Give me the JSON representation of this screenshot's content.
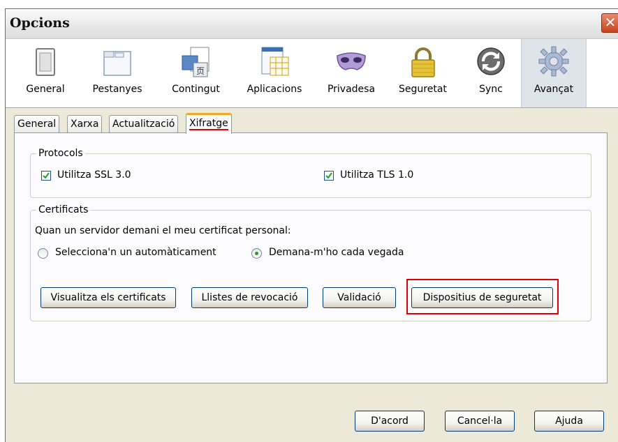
{
  "window": {
    "title": "Opcions",
    "close_glyph": "✕"
  },
  "toolbar": {
    "items": [
      {
        "label": "General",
        "icon": "general-icon"
      },
      {
        "label": "Pestanyes",
        "icon": "tabs-icon"
      },
      {
        "label": "Contingut",
        "icon": "content-icon"
      },
      {
        "label": "Aplicacions",
        "icon": "applications-icon"
      },
      {
        "label": "Privadesa",
        "icon": "privacy-mask-icon"
      },
      {
        "label": "Seguretat",
        "icon": "lock-icon"
      },
      {
        "label": "Sync",
        "icon": "sync-icon"
      },
      {
        "label": "Avançat",
        "icon": "gear-icon",
        "active": true
      }
    ]
  },
  "tabs": {
    "items": [
      "General",
      "Xarxa",
      "Actualització",
      "Xifratge"
    ],
    "selected": "Xifratge"
  },
  "protocols": {
    "legend": "Protocols",
    "ssl": {
      "label": "Utilitza SSL 3.0",
      "checked": true
    },
    "tls": {
      "label": "Utilitza TLS 1.0",
      "checked": true
    }
  },
  "certificates": {
    "legend": "Certificats",
    "prompt": "Quan un servidor demani el meu certificat personal:",
    "option_auto": "Selecciona'n un automàticament",
    "option_ask": "Demana-m'ho cada vegada",
    "selected_option": "Demana-m'ho cada vegada",
    "buttons": {
      "view": "Visualitza els certificats",
      "revocation": "Llistes de revocació",
      "validation": "Validació",
      "devices": "Dispositius de seguretat"
    }
  },
  "footer": {
    "ok": "D'acord",
    "cancel": "Cancel·la",
    "help": "Ajuda"
  },
  "colors": {
    "highlight": "#e00000",
    "tab_accent": "#f5a623",
    "check": "#21a121"
  }
}
